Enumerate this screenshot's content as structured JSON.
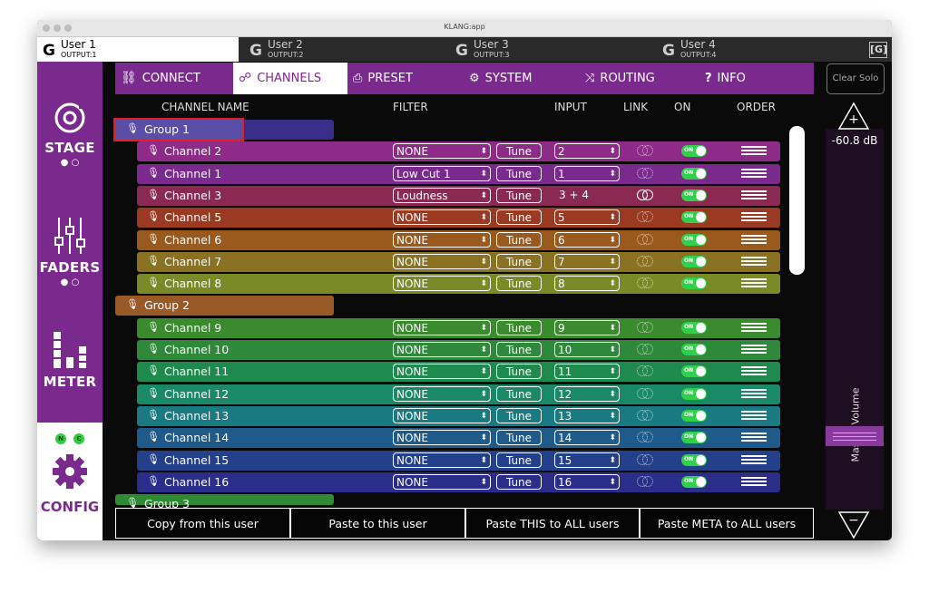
{
  "window": {
    "title": "KLANG:app"
  },
  "users": [
    {
      "name": "User 1",
      "output": "OUTPUT:1",
      "active": true
    },
    {
      "name": "User 2",
      "output": "OUTPUT:2",
      "active": false
    },
    {
      "name": "User 3",
      "output": "OUTPUT:3",
      "active": false
    },
    {
      "name": "User 4",
      "output": "OUTPUT:4",
      "active": false
    }
  ],
  "corner_button": "[G]",
  "sidebar": {
    "stage": "STAGE",
    "faders": "FADERS",
    "meter": "METER",
    "config": "CONFIG",
    "dots": "● ○",
    "n_badge": "N",
    "c_badge": "C"
  },
  "nav": {
    "connect": "CONNECT",
    "channels": "CHANNELS",
    "preset": "PRESET",
    "system": "SYSTEM",
    "routing": "ROUTING",
    "info": "INFO"
  },
  "clear_solo": "Clear Solo",
  "headers": {
    "name": "CHANNEL NAME",
    "filter": "FILTER",
    "input": "INPUT",
    "link": "LINK",
    "on": "ON",
    "order": "ORDER"
  },
  "tune_label": "Tune",
  "on_label": "ON",
  "groups": [
    {
      "name": "Group 1",
      "color": "#3a2e8a"
    },
    {
      "name": "Group 2",
      "color": "#9a5a28"
    },
    {
      "name": "Group 3",
      "color": "#2e8a34"
    }
  ],
  "channels": [
    {
      "name": "Channel 2",
      "filter": "NONE",
      "input": "2",
      "linked": false,
      "color": "#8e2a88"
    },
    {
      "name": "Channel 1",
      "filter": "Low Cut 1",
      "input": "1",
      "linked": false,
      "color": "#7a2a8c"
    },
    {
      "name": "Channel 3",
      "filter": "Loudness",
      "input": "3 + 4",
      "linked": true,
      "color": "#8a2a52"
    },
    {
      "name": "Channel 5",
      "filter": "NONE",
      "input": "5",
      "linked": false,
      "color": "#9a3a22"
    },
    {
      "name": "Channel 6",
      "filter": "NONE",
      "input": "6",
      "linked": false,
      "color": "#9a5a1e"
    },
    {
      "name": "Channel 7",
      "filter": "NONE",
      "input": "7",
      "linked": false,
      "color": "#8a7222"
    },
    {
      "name": "Channel 8",
      "filter": "NONE",
      "input": "8",
      "linked": false,
      "color": "#7a8a26"
    },
    {
      "name": "Channel 9",
      "filter": "NONE",
      "input": "9",
      "linked": false,
      "color": "#3a8a2e"
    },
    {
      "name": "Channel 10",
      "filter": "NONE",
      "input": "10",
      "linked": false,
      "color": "#2e8a3a"
    },
    {
      "name": "Channel 11",
      "filter": "NONE",
      "input": "11",
      "linked": false,
      "color": "#1e8a4e"
    },
    {
      "name": "Channel 12",
      "filter": "NONE",
      "input": "12",
      "linked": false,
      "color": "#1a8a66"
    },
    {
      "name": "Channel 13",
      "filter": "NONE",
      "input": "13",
      "linked": false,
      "color": "#1a7a82"
    },
    {
      "name": "Channel 14",
      "filter": "NONE",
      "input": "14",
      "linked": false,
      "color": "#1e5a8a"
    },
    {
      "name": "Channel 15",
      "filter": "NONE",
      "input": "15",
      "linked": false,
      "color": "#24408a"
    },
    {
      "name": "Channel 16",
      "filter": "NONE",
      "input": "16",
      "linked": false,
      "color": "#2a2e8a"
    }
  ],
  "master": {
    "db": "-60.8 dB",
    "label": "Master Volume",
    "plus": "+",
    "minus": "−"
  },
  "bottom": {
    "copy": "Copy from this user",
    "paste": "Paste to this user",
    "paste_all": "Paste THIS to ALL users",
    "paste_meta": "Paste META to ALL users"
  },
  "accent": "#7a2a8c"
}
